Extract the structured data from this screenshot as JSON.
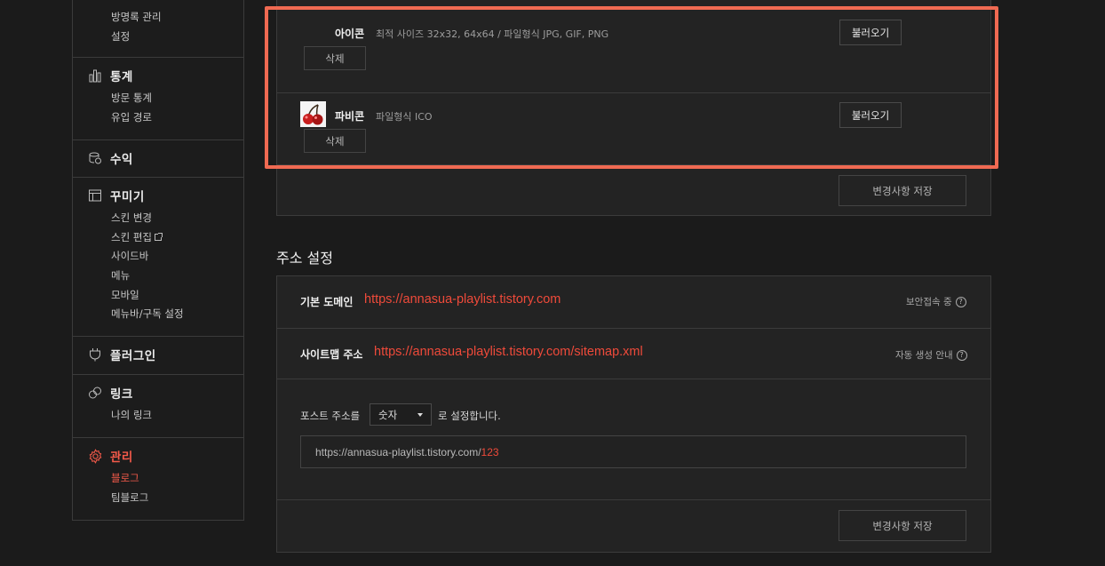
{
  "sidebar": {
    "top_items": [
      "방명록 관리",
      "설정"
    ],
    "stats": {
      "title": "통계",
      "items": [
        "방문 통계",
        "유입 경로"
      ]
    },
    "revenue": {
      "title": "수익"
    },
    "decorate": {
      "title": "꾸미기",
      "items": [
        "스킨 변경",
        "스킨 편집",
        "사이드바",
        "메뉴",
        "모바일",
        "메뉴바/구독 설정"
      ]
    },
    "plugin": {
      "title": "플러그인"
    },
    "link": {
      "title": "링크",
      "items": [
        "나의 링크"
      ]
    },
    "manage": {
      "title": "관리",
      "items": [
        "블로그",
        "팀블로그"
      ],
      "active_item": "블로그"
    }
  },
  "icon_section": {
    "icon": {
      "label": "아이콘",
      "desc": "최적 사이즈 32x32, 64x64 / 파일형식 JPG, GIF, PNG",
      "load_btn": "불러오기",
      "delete_btn": "삭제"
    },
    "favicon": {
      "label": "파비콘",
      "desc": "파일형식 ICO",
      "load_btn": "불러오기",
      "delete_btn": "삭제"
    },
    "save_btn": "변경사항 저장"
  },
  "address": {
    "title": "주소 설정",
    "domain_label": "기본 도메인",
    "domain_url": "https://annasua-playlist.tistory.com",
    "domain_info": "보안접속 중",
    "sitemap_label": "사이트맵 주소",
    "sitemap_url": "https://annasua-playlist.tistory.com/sitemap.xml",
    "sitemap_info": "자동 생성 안내",
    "post_prefix": "포스트 주소를",
    "post_select": "숫자",
    "post_suffix": "로 설정합니다.",
    "example_base": "https://annasua-playlist.tistory.com/",
    "example_num": "123",
    "save_btn": "변경사항 저장"
  },
  "colors": {
    "accent": "#ef4a3a",
    "highlight": "#f06a52",
    "background": "#1b1b1b"
  }
}
